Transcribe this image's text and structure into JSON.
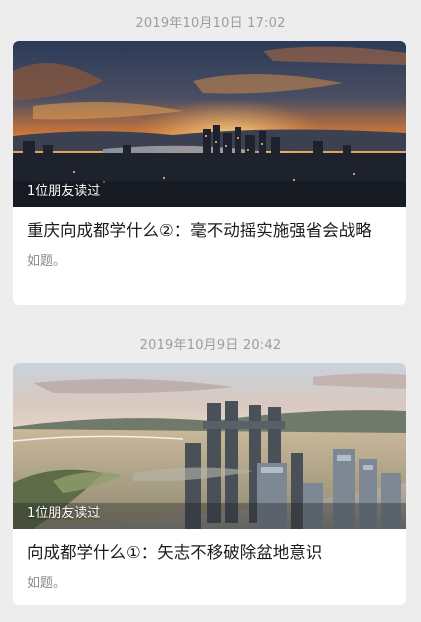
{
  "articles": [
    {
      "timestamp": "2019年10月10日 17:02",
      "read_badge": "1位朋友读过",
      "title": "重庆向成都学什么②：毫不动摇实施强省会战略",
      "summary": "如题。",
      "image_icon": "city-sunset-photo"
    },
    {
      "timestamp": "2019年10月9日 20:42",
      "read_badge": "1位朋友读过",
      "title": "向成都学什么①：矢志不移破除盆地意识",
      "summary": "如题。",
      "image_icon": "city-daytime-photo"
    }
  ]
}
